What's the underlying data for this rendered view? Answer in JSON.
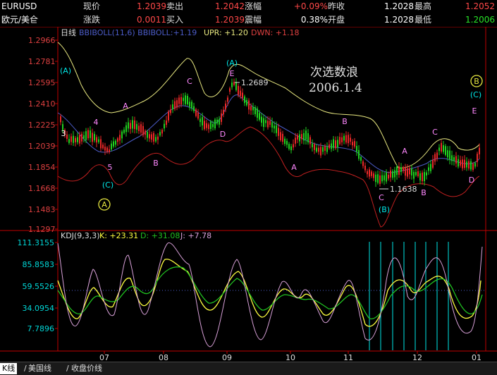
{
  "quote": {
    "symbol": "EURUSD",
    "name": "欧元/美仺",
    "row1": {
      "current_label": "现价",
      "current_value": "1.2039",
      "sell_label": "卖出",
      "sell_value": "1.2042",
      "change_pct_label": "涨幅",
      "change_pct_value": "+0.09%",
      "prev_close_label": "昨收",
      "prev_close_value": "1.2028",
      "high_label": "最高",
      "high_value": "1.2052"
    },
    "row2": {
      "change_label": "涨跌",
      "change_value": "0.0011",
      "buy_label": "买入",
      "buy_value": "1.2039",
      "amplitude_label": "震幅",
      "amplitude_value": "0.38%",
      "open_label": "开盘",
      "open_value": "1.2028",
      "low_label": "最低",
      "low_value": "1.2006"
    }
  },
  "main_chart": {
    "period_label": "日线",
    "indicator_label": "BBIBOLL(11,6) BBIBOLL:+1.19",
    "upr_label": "UPR: +1.20",
    "dwn_label": "DWN: +1.18",
    "y_ticks": [
      "1.2966",
      "1.2781",
      "1.2595",
      "1.2410",
      "1.2225",
      "1.2039",
      "1.1854",
      "1.1668",
      "1.1483",
      "1.1297"
    ],
    "annotation_title": "次选数浪",
    "annotation_date": "2006.1.4",
    "high_marker": "1.2689",
    "low_marker": "1.1638",
    "wave_labels": [
      {
        "text": "(A)",
        "color": "#00e8e8",
        "x": 93,
        "y": 104
      },
      {
        "text": "3",
        "color": "#ffffff",
        "x": 90,
        "y": 193
      },
      {
        "text": "4",
        "color": "#ff88ff",
        "x": 136,
        "y": 177
      },
      {
        "text": "5",
        "color": "#ff88ff",
        "x": 156,
        "y": 241
      },
      {
        "text": "(C)",
        "color": "#00e8e8",
        "x": 153,
        "y": 266
      },
      {
        "text": "A",
        "color": "#ff88ff",
        "x": 178,
        "y": 154
      },
      {
        "text": "B",
        "color": "#ff88ff",
        "x": 221,
        "y": 235
      },
      {
        "text": "C",
        "color": "#ff88ff",
        "x": 269,
        "y": 119
      },
      {
        "text": "D",
        "color": "#ff88ff",
        "x": 316,
        "y": 194
      },
      {
        "text": "(A)",
        "color": "#00e8e8",
        "x": 329,
        "y": 93
      },
      {
        "text": "E",
        "color": "#ff88ff",
        "x": 329,
        "y": 108
      },
      {
        "text": "A",
        "color": "#ff88ff",
        "x": 417,
        "y": 241
      },
      {
        "text": "B",
        "color": "#ff88ff",
        "x": 489,
        "y": 176
      },
      {
        "text": "A",
        "color": "#ff88ff",
        "x": 574,
        "y": 218
      },
      {
        "text": "C",
        "color": "#ff88ff",
        "x": 541,
        "y": 284
      },
      {
        "text": "(B)",
        "color": "#00e8e8",
        "x": 545,
        "y": 301
      },
      {
        "text": "B",
        "color": "#ff88ff",
        "x": 601,
        "y": 277
      },
      {
        "text": "C",
        "color": "#ff88ff",
        "x": 617,
        "y": 191
      },
      {
        "text": "D",
        "color": "#ff88ff",
        "x": 669,
        "y": 259
      },
      {
        "text": "(C)",
        "color": "#00e8e8",
        "x": 675,
        "y": 138
      },
      {
        "text": "E",
        "color": "#ff88ff",
        "x": 673,
        "y": 161
      }
    ],
    "circle_labels": [
      {
        "text": "A",
        "x": 148,
        "y": 290
      },
      {
        "text": "B",
        "x": 676,
        "y": 115
      }
    ]
  },
  "kdj_chart": {
    "label": "KDJ(9,3,3)",
    "k_label": "K: +23.31",
    "d_label": "D: +31.08",
    "j_label": "J: +7.78",
    "y_ticks": [
      "111.3155",
      "85.8583",
      "59.5526",
      "34.0954",
      "7.7896"
    ]
  },
  "x_axis": {
    "ticks": [
      "07",
      "08",
      "09",
      "10",
      "11",
      "12",
      "01"
    ]
  },
  "bottom_tabs": [
    {
      "label": "K线",
      "active": true
    },
    {
      "label": "美国线",
      "active": false
    },
    {
      "label": "收盘价线",
      "active": false
    }
  ],
  "colors": {
    "background": "#000000",
    "axis": "#c00000",
    "upper_band": "#e8e880",
    "lower_band": "#c02020",
    "mid_band": "#4c5cc8",
    "candle_up": "#e82828",
    "candle_down": "#20d020",
    "k_line": "#ffff40",
    "d_line": "#20c020",
    "j_line": "#d8a0d8",
    "cyan_marks": "#00e8e8"
  }
}
